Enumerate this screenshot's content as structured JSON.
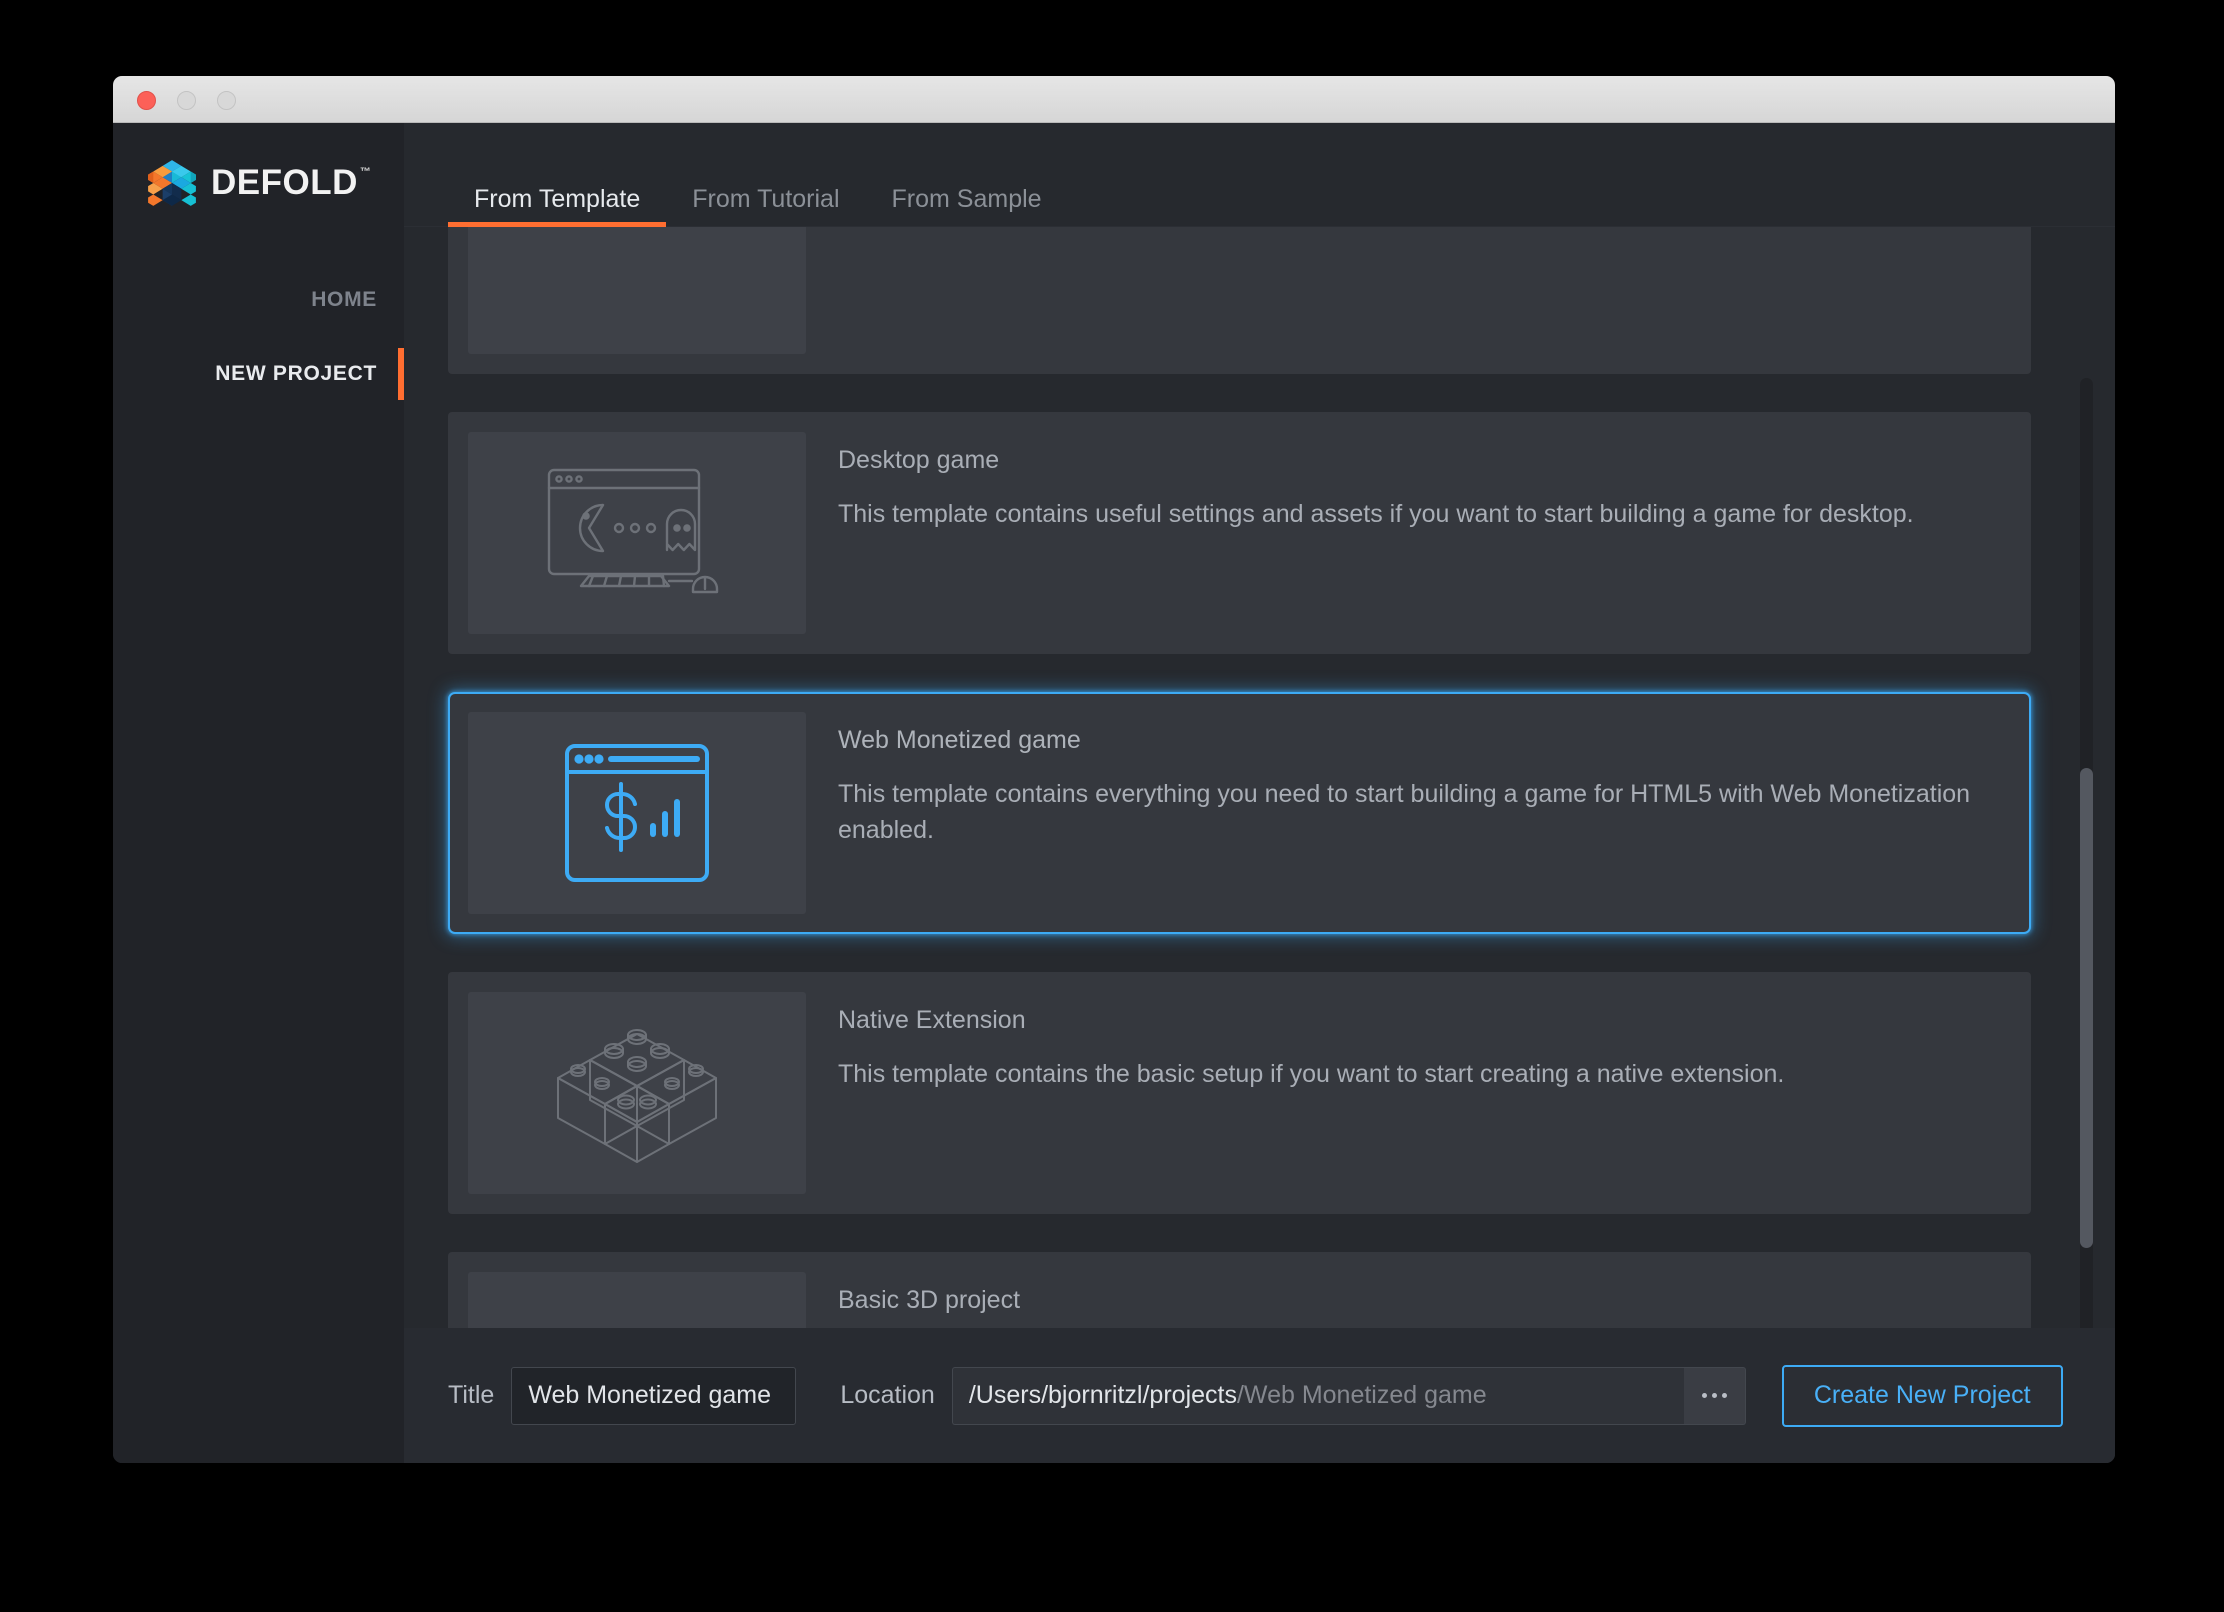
{
  "window": {
    "traffic_lights": [
      "close",
      "minimize",
      "zoom"
    ]
  },
  "sidebar": {
    "logo_text": "DEFOLD",
    "logo_tm": "™",
    "items": [
      {
        "label": "HOME",
        "active": false
      },
      {
        "label": "NEW PROJECT",
        "active": true
      }
    ]
  },
  "tabs": [
    {
      "label": "From Template",
      "active": true
    },
    {
      "label": "From Tutorial",
      "active": false
    },
    {
      "label": "From Sample",
      "active": false
    }
  ],
  "templates": [
    {
      "title": "",
      "description": "",
      "icon": "blank-icon",
      "selected": false,
      "partial": true
    },
    {
      "title": "Desktop game",
      "description": "This template contains useful settings and assets if you want to start building a game for desktop.",
      "icon": "desktop-monitor-pacman-icon",
      "selected": false,
      "partial": false
    },
    {
      "title": "Web Monetized game",
      "description": "This template contains everything you need to start building a game for HTML5 with Web Monetization enabled.",
      "icon": "browser-dollar-signal-icon",
      "selected": true,
      "partial": false
    },
    {
      "title": "Native Extension",
      "description": "This template contains the basic setup if you want to start creating a native extension.",
      "icon": "lego-bricks-icon",
      "selected": false,
      "partial": false
    },
    {
      "title": "Basic 3D project",
      "description": "",
      "icon": "blank-icon",
      "selected": false,
      "partial": true
    }
  ],
  "bottom_bar": {
    "title_label": "Title",
    "title_value": "Web Monetized game",
    "location_label": "Location",
    "location_path": "/Users/bjornritzl/projects",
    "location_suffix": "/Web Monetized game",
    "browse_label": "...",
    "create_label": "Create New Project"
  },
  "colors": {
    "accent_orange": "#ff6e31",
    "accent_blue": "#3dabf5",
    "window_bg": "#26292e",
    "sidebar_bg": "#212328",
    "card_bg": "#35383e",
    "thumb_bg": "#3e4148",
    "bottom_bar_bg": "#282b31",
    "text_primary": "#e7eaee",
    "text_muted": "#a9aeb6"
  },
  "scrollbar": {
    "orientation": "vertical",
    "thumb_position_pct": 38
  }
}
